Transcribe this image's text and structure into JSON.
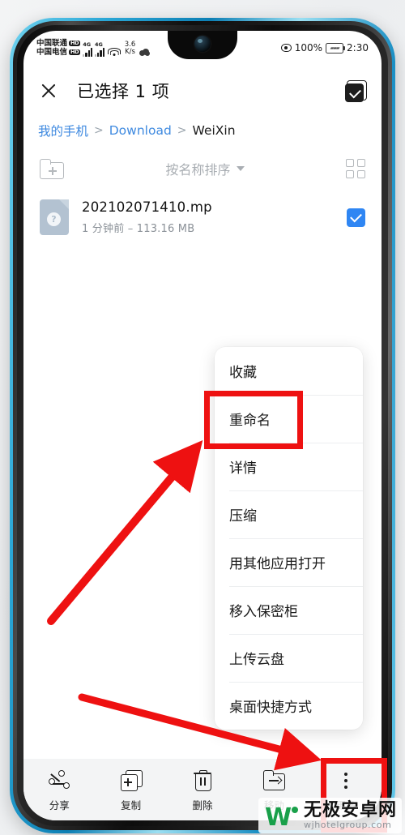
{
  "status_bar": {
    "carrier_1": "中国联通",
    "carrier_1_badge": "HD",
    "carrier_2": "中国电信",
    "carrier_2_badge": "HD",
    "network_1": "4G",
    "network_2": "4G",
    "wifi_icon": "wifi-icon",
    "net_speed_value": "3.6",
    "net_speed_unit": "K/s",
    "cloud_icon": "cloud-sync-icon",
    "eye_icon": "eye-comfort-icon",
    "battery_percent": "100%",
    "battery_icon": "battery-charging-icon",
    "time": "2:30"
  },
  "header": {
    "close_icon": "close-icon",
    "title": "已选择 1 项",
    "select_all_icon": "select-all-checked-icon"
  },
  "breadcrumb": {
    "items": [
      {
        "label": "我的手机",
        "is_link": true
      },
      {
        "label": "Download",
        "is_link": true
      },
      {
        "label": "WeiXin",
        "is_link": false
      }
    ],
    "separator": ">"
  },
  "toolbar": {
    "new_folder_icon": "new-folder-icon",
    "sort_label": "按名称排序",
    "sort_caret_icon": "chevron-down-icon",
    "grid_view_icon": "grid-view-icon"
  },
  "file_list": [
    {
      "icon": "unknown-file-icon",
      "icon_badge": "?",
      "name": "202102071410.mp",
      "meta": "1 分钟前 – 113.16 MB",
      "selected": true
    }
  ],
  "popup_menu": {
    "items": [
      {
        "label": "收藏"
      },
      {
        "label": "重命名",
        "highlighted": true
      },
      {
        "label": "详情"
      },
      {
        "label": "压缩"
      },
      {
        "label": "用其他应用打开"
      },
      {
        "label": "移入保密柜"
      },
      {
        "label": "上传云盘"
      },
      {
        "label": "桌面快捷方式"
      }
    ]
  },
  "bottom_bar": {
    "items": [
      {
        "label": "分享",
        "icon": "share-icon"
      },
      {
        "label": "复制",
        "icon": "copy-icon"
      },
      {
        "label": "删除",
        "icon": "trash-icon"
      },
      {
        "label": "移动",
        "icon": "move-to-folder-icon"
      },
      {
        "label": "更多",
        "icon": "more-vertical-icon",
        "highlighted": true
      }
    ]
  },
  "annotations": {
    "highlight_color": "#ee1111",
    "rename_box_target": "重命名",
    "more_box_target": "更多",
    "arrow_1": "arrow pointing up-right to 重命名",
    "arrow_2": "arrow pointing down-right to 更多"
  },
  "watermark": {
    "logo_letter": "W",
    "site_name": "无极安卓网",
    "site_url": "wjhotelgroup.com",
    "brand_color": "#19a04a"
  }
}
